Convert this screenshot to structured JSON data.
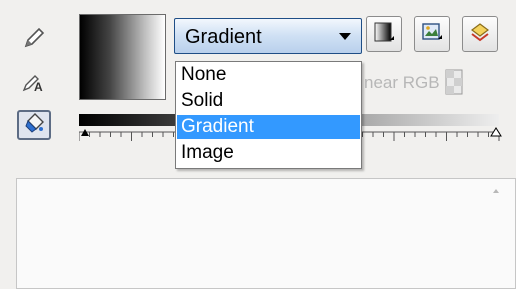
{
  "fill_type": {
    "selected": "Gradient",
    "options": [
      "None",
      "Solid",
      "Gradient",
      "Image"
    ]
  },
  "interpolation_label": "near RGB",
  "colors": {
    "selection": "#3399ff",
    "combo_border": "#1f4e86"
  },
  "icons": {
    "left_tools": [
      "pencil-icon",
      "text-tool-icon",
      "fill-bucket-icon"
    ],
    "top_buttons": [
      "gradient-swatch-icon",
      "image-effect-icon",
      "color-swap-icon"
    ],
    "background": "background-grid-icon",
    "stop": "gradient-stop-icon"
  }
}
